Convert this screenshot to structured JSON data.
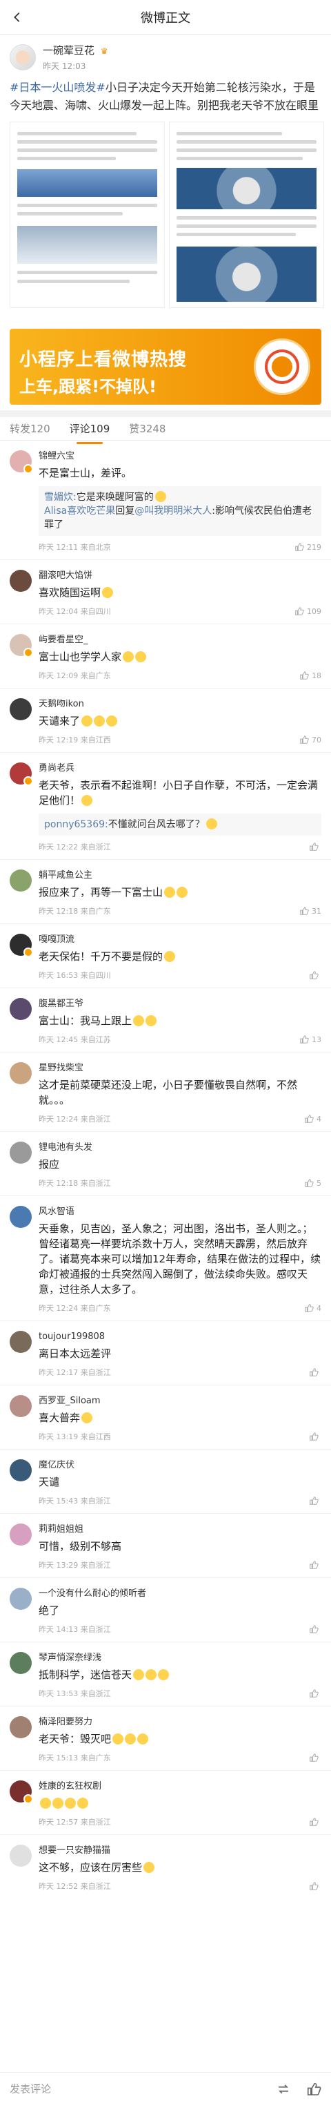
{
  "header": {
    "title": "微博正文"
  },
  "post": {
    "author": "一碗荤豆花",
    "time": "昨天 12:03",
    "tag": "#日本一火山喷发#",
    "text": "小日子决定今天开始第二轮核污染水，于是今天地震、海啸、火山爆发一起上阵。别把我老天爷不放在眼里"
  },
  "banner": {
    "line1": "小程序上看微博热搜",
    "line2": "上车,跟紧!不掉队!"
  },
  "tabs": [
    {
      "label": "转发120"
    },
    {
      "label": "评论109"
    },
    {
      "label": "赞3248"
    }
  ],
  "comments": [
    {
      "name": "锦鲤六宝",
      "text": "不是富士山，差评。",
      "reply1_user": "雪媚炊:",
      "reply1_text": "它是来唤醒阿富的",
      "reply2_user": "Alisa喜欢吃芒果",
      "reply2_mid": "回复",
      "reply2_at": "@叫我明明米大人",
      "reply2_text": ":影响气候农民伯伯遭老罪了",
      "meta": "昨天 12:11 来自北京",
      "likes": "219"
    },
    {
      "name": "翻滚吧大馅饼",
      "text": "喜欢随国运啊",
      "meta": "昨天 12:04 来自四川",
      "likes": "109"
    },
    {
      "name": "屿要看星空_",
      "text": "富士山也学学人家",
      "meta": "昨天 12:09 来自广东",
      "likes": "18"
    },
    {
      "name": "天鹅吻ikon",
      "text": "天谴来了",
      "meta": "昨天 12:19 来自江西",
      "likes": "70"
    },
    {
      "name": "勇尚老兵",
      "text": "老天爷，表示看不起谁啊！小日子自作孽，不可活，一定会满足他们！",
      "reply1_user": "ponny65369:",
      "reply1_text": "不懂就问台风去哪了？",
      "meta": "昨天 12:22 来自浙江",
      "likes": ""
    },
    {
      "name": "躺平咸鱼公主",
      "text": "报应来了，再等一下富士山",
      "meta": "昨天 12:18 来自广东",
      "likes": "31"
    },
    {
      "name": "嘎嘎顶流",
      "text": "老天保佑！千万不要是假的",
      "meta": "昨天 16:53 来自四川",
      "likes": ""
    },
    {
      "name": "腹黑都王爷",
      "text": "富士山：我马上跟上",
      "meta": "昨天 12:45 来自江苏",
      "likes": "13"
    },
    {
      "name": "星野找柴宝",
      "text": "这才是前菜硬菜还没上呢，小日子要懂敬畏自然啊，不然就。。。",
      "meta": "昨天 12:24 来自浙江",
      "likes": "4"
    },
    {
      "name": "锂电池有头发",
      "text": "报应",
      "meta": "昨天 12:18 来自浙江",
      "likes": "5"
    },
    {
      "name": "风水智语",
      "text": "天垂象，见吉凶，圣人象之；河出图，洛出书，圣人则之。；曾经诸葛亮一样要坑杀数十万人，突然晴天霹雳，然后放弃了。诸葛亮本来可以增加12年寿命，结果在做法的过程中，续命灯被通报的士兵突然闯入踢倒了，做法续命失败。感叹天意，过往杀人太多了。",
      "meta": "昨天 12:24 来自广东",
      "likes": "4"
    },
    {
      "name": "toujour199808",
      "text": "离日本太远差评",
      "meta": "昨天 12:17 来自浙江",
      "likes": ""
    },
    {
      "name": "西罗亚_Siloam",
      "text": "喜大普奔",
      "meta": "昨天 13:19 来自江西",
      "likes": ""
    },
    {
      "name": "魔亿庆伏",
      "text": "天谴",
      "meta": "昨天 15:43 来自浙江",
      "likes": ""
    },
    {
      "name": "莉莉姐姐姐",
      "text": "可惜，级别不够高",
      "meta": "昨天 13:29 来自浙江",
      "likes": ""
    },
    {
      "name": "一个没有什么耐心的倾听者",
      "text": "绝了",
      "meta": "昨天 14:13 来自浙江",
      "likes": ""
    },
    {
      "name": "琴声悄深奈绿浅",
      "text": "抵制科学，迷信苍天",
      "meta": "昨天 13:53 来自浙江",
      "likes": ""
    },
    {
      "name": "楠泽阳要努力",
      "text": "老天爷：毁灭吧",
      "meta": "昨天 15:13 来自广东",
      "likes": ""
    },
    {
      "name": "姓康的玄狂权剧",
      "text": "",
      "meta": "昨天 12:57 来自浙江",
      "likes": ""
    },
    {
      "name": "想要一只安静猫猫",
      "text": "这不够，应该在厉害些",
      "meta": "昨天 12:52 来自浙江",
      "likes": ""
    }
  ],
  "bottom": {
    "placeholder": "发表评论"
  },
  "colors": {
    "accent": "#f08a00",
    "link": "#3f6ba8"
  }
}
